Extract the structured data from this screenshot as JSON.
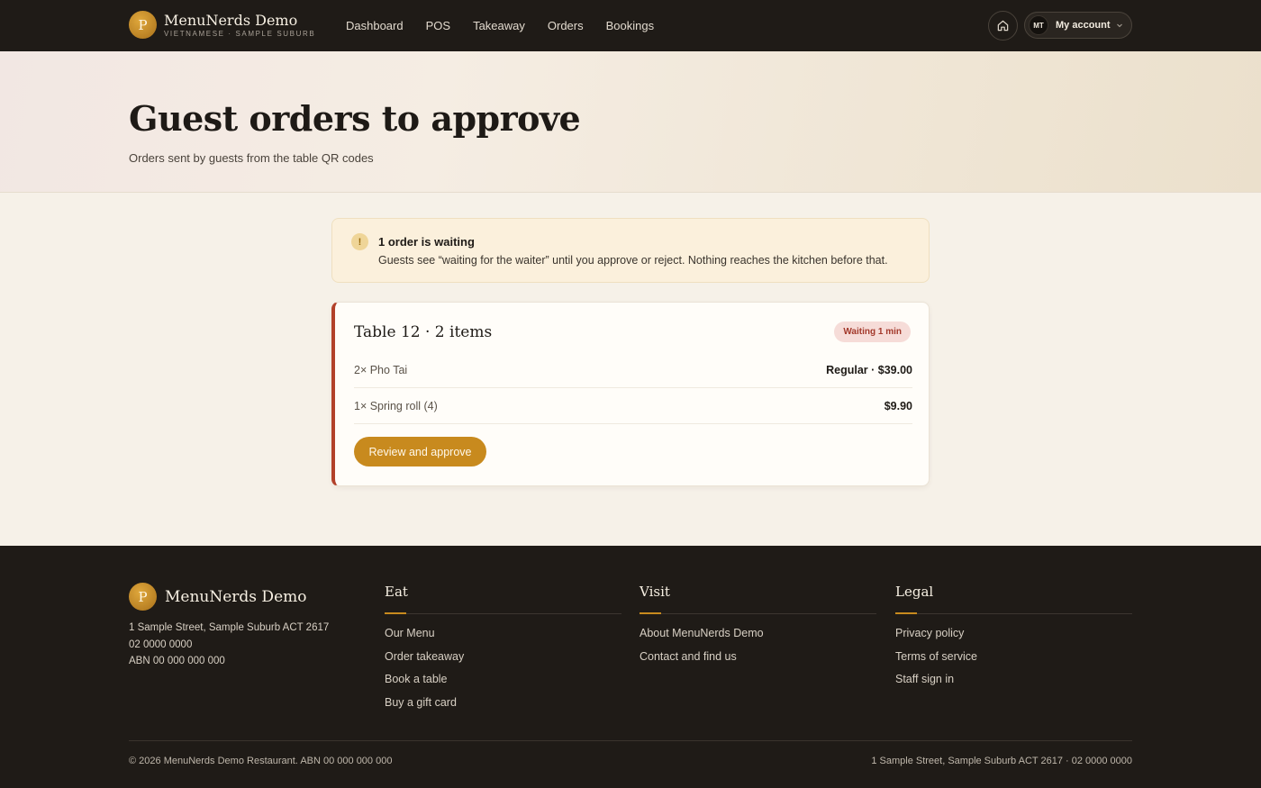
{
  "brand": {
    "initial": "P",
    "name": "MenuNerds Demo",
    "subtitle": "VIETNAMESE · SAMPLE SUBURB"
  },
  "nav": {
    "items": [
      "Dashboard",
      "POS",
      "Takeaway",
      "Orders",
      "Bookings"
    ]
  },
  "account": {
    "initials": "MT",
    "label": "My account"
  },
  "icons": {
    "home": "home-icon",
    "chevron": "chevron-down-icon",
    "alert": "exclamation-icon"
  },
  "hero": {
    "title": "Guest orders to approve",
    "subtitle": "Orders sent by guests from the table QR codes"
  },
  "alert": {
    "icon_text": "!",
    "title": "1 order is waiting",
    "text": "Guests see “waiting for the waiter” until you approve or reject. Nothing reaches the kitchen before that."
  },
  "order": {
    "title": "Table 12 · 2 items",
    "badge": "Waiting 1 min",
    "items": [
      {
        "name": "2× Pho Tai",
        "price": "Regular · $39.00"
      },
      {
        "name": "1× Spring roll (4)",
        "price": "$9.90"
      }
    ],
    "action": "Review and approve"
  },
  "footer": {
    "brand_name": "MenuNerds Demo",
    "address": "1 Sample Street, Sample Suburb ACT 2617",
    "phone": "02 0000 0000",
    "abn": "ABN 00 000 000 000",
    "columns": [
      {
        "title": "Eat",
        "links": [
          "Our Menu",
          "Order takeaway",
          "Book a table",
          "Buy a gift card"
        ]
      },
      {
        "title": "Visit",
        "links": [
          "About MenuNerds Demo",
          "Contact and find us"
        ]
      },
      {
        "title": "Legal",
        "links": [
          "Privacy policy",
          "Terms of service",
          "Staff sign in"
        ]
      }
    ],
    "copyright": "© 2026 MenuNerds Demo Restaurant. ABN 00 000 000 000",
    "bottom_address": "1 Sample Street, Sample Suburb ACT 2617 · 02 0000 0000"
  },
  "colors": {
    "accent": "#c88a1e",
    "dark": "#1f1b17",
    "waiting_red": "#b2412a",
    "background": "#f6f1e8"
  }
}
